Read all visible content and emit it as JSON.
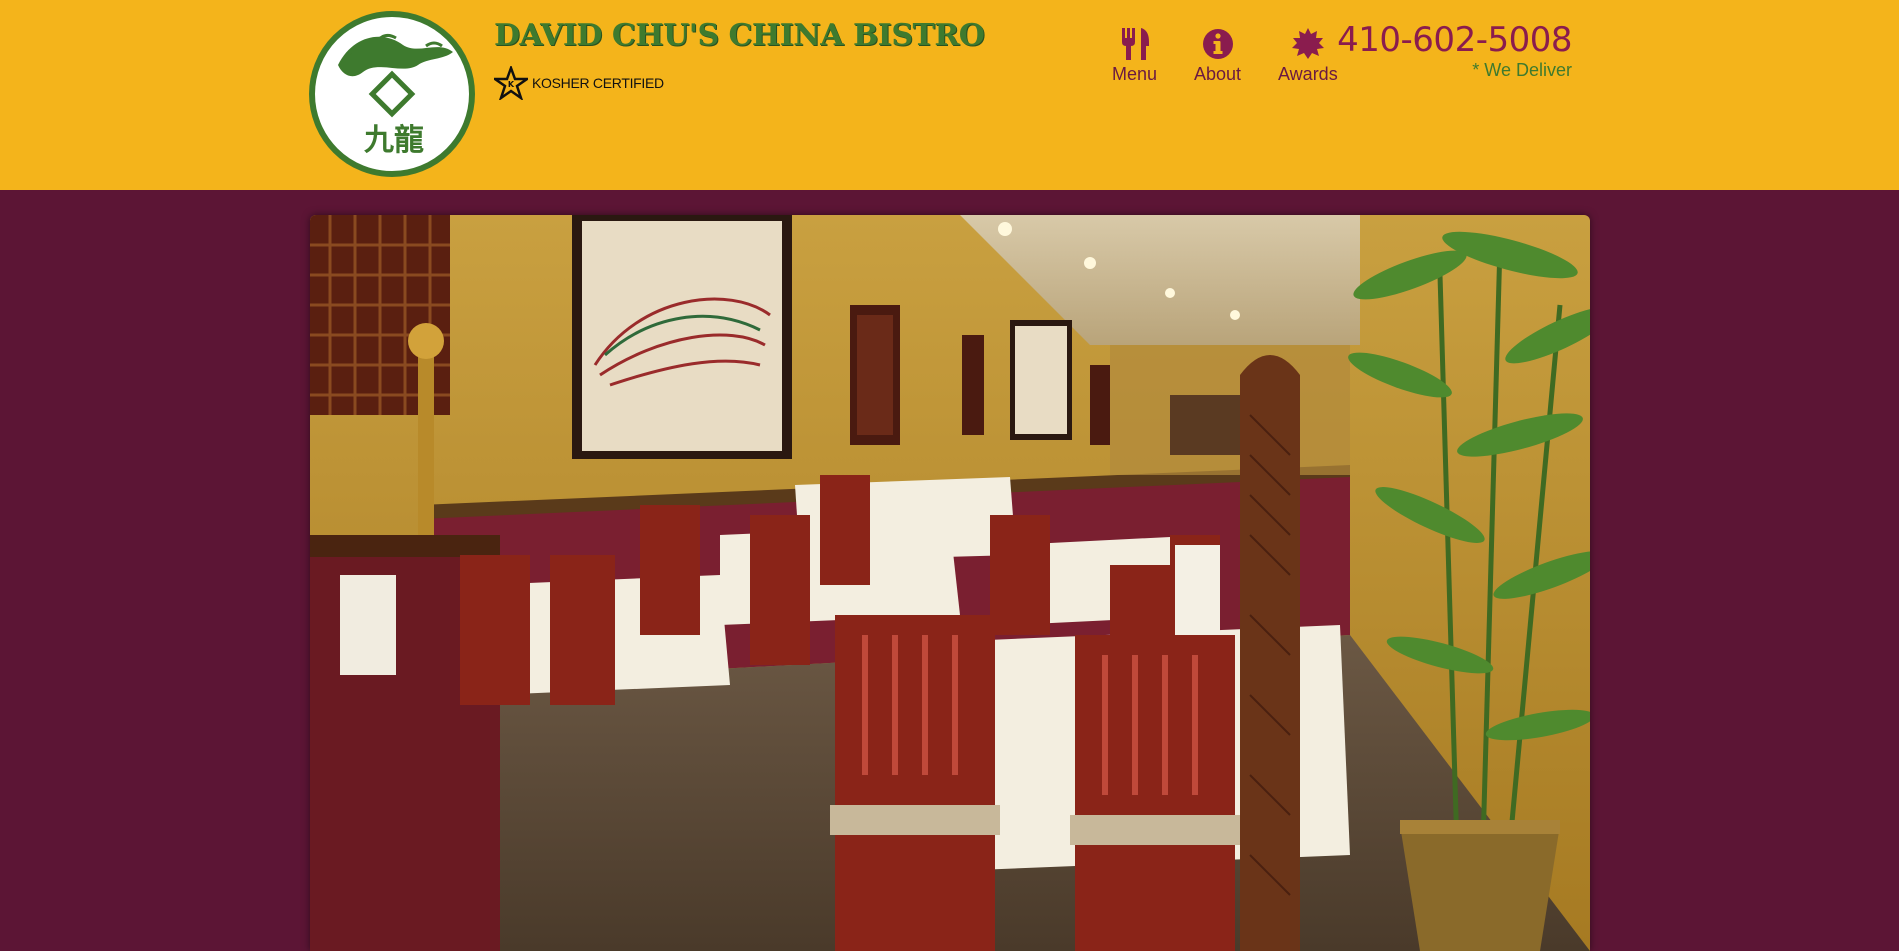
{
  "header": {
    "title": "DAVID CHU'S CHINA BISTRO",
    "kosher_label": "KOSHER CERTIFIED",
    "logo_chars": [
      "九",
      "龍"
    ],
    "phone": "410-602-5008",
    "deliver": "* We Deliver",
    "background_color": "#f4b41b"
  },
  "nav": [
    {
      "label": "Menu",
      "icon": "fork-knife-icon"
    },
    {
      "label": "About",
      "icon": "info-icon"
    },
    {
      "label": "Awards",
      "icon": "award-seal-icon"
    }
  ],
  "colors": {
    "accent": "#8a1c4e",
    "brand_green": "#3e7a2e",
    "page_background": "#5c1535"
  },
  "hero": {
    "description_icon": "restaurant-dining-room-photo"
  }
}
